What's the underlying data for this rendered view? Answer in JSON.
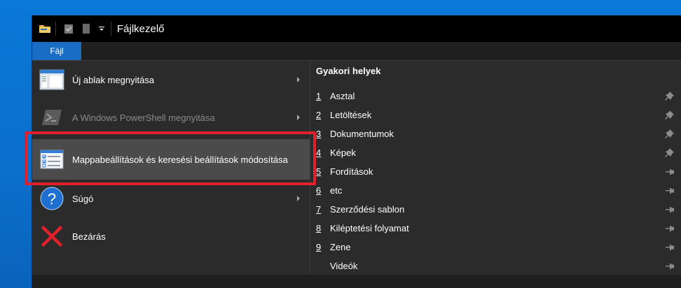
{
  "window": {
    "title": "Fájlkezelő"
  },
  "ribbon": {
    "file_tab": "Fájl"
  },
  "menu": {
    "commands": [
      {
        "label": "Új ablak megnyitása",
        "icon": "new-window-icon",
        "has_submenu": true,
        "disabled": false
      },
      {
        "label": "A Windows PowerShell megnyitása",
        "icon": "powershell-icon",
        "has_submenu": true,
        "disabled": true
      },
      {
        "label": "Mappabeállítások és keresési beállítások módosítása",
        "icon": "folder-options-icon",
        "has_submenu": false,
        "disabled": false,
        "highlighted": true
      },
      {
        "label": "Súgó",
        "icon": "help-icon",
        "has_submenu": true,
        "disabled": false
      },
      {
        "label": "Bezárás",
        "icon": "close-icon",
        "has_submenu": false,
        "disabled": false
      }
    ]
  },
  "places": {
    "title": "Gyakori helyek",
    "items": [
      {
        "num": "1",
        "name": "Asztal",
        "pinned": true
      },
      {
        "num": "2",
        "name": "Letöltések",
        "pinned": true
      },
      {
        "num": "3",
        "name": "Dokumentumok",
        "pinned": true
      },
      {
        "num": "4",
        "name": "Képek",
        "pinned": true
      },
      {
        "num": "5",
        "name": "Fordítások",
        "pinned": false
      },
      {
        "num": "6",
        "name": "etc",
        "pinned": false
      },
      {
        "num": "7",
        "name": "Szerződési sablon",
        "pinned": false
      },
      {
        "num": "8",
        "name": "Kiléptetési folyamat",
        "pinned": false
      },
      {
        "num": "9",
        "name": "Zene",
        "pinned": false
      },
      {
        "num": "",
        "name": "Videók",
        "pinned": false
      }
    ]
  },
  "colors": {
    "accent": "#1a6dc5",
    "highlight_border": "#e0202a",
    "menu_bg": "#2b2b2b"
  }
}
